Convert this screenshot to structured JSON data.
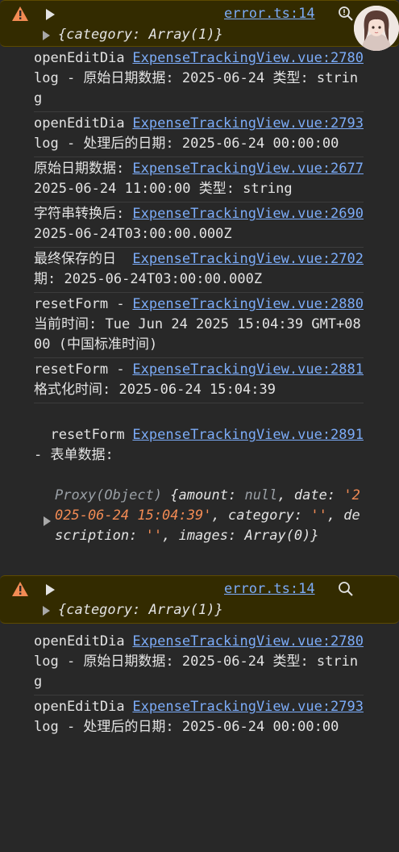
{
  "errors": [
    {
      "source": "error.ts:14",
      "object": "{category: Array(1)}"
    },
    {
      "source": "error.ts:14",
      "object": "{category: Array(1)}"
    }
  ],
  "logs1": [
    {
      "message": "openEditDialog - 原始日期数据: 2025-06-24 类型: string",
      "source": "ExpenseTrackingView.vue:2780"
    },
    {
      "message": "openEditDialog - 处理后的日期: 2025-06-24 00:00:00",
      "source": "ExpenseTrackingView.vue:2793"
    },
    {
      "message": "原始日期数据: 2025-06-24 11:00:00 类型: string",
      "source": "ExpenseTrackingView.vue:2677"
    },
    {
      "message": "字符串转换后: 2025-06-24T03:00:00.000Z",
      "source": "ExpenseTrackingView.vue:2690"
    },
    {
      "message": "最终保存的日期: 2025-06-24T03:00:00.000Z",
      "source": "ExpenseTrackingView.vue:2702"
    },
    {
      "message": "resetForm - 当前时间: Tue Jun 24 2025 15:04:39 GMT+0800 (中国标准时间)",
      "source": "ExpenseTrackingView.vue:2880"
    },
    {
      "message": "resetForm - 格式化时间: 2025-06-24 15:04:39",
      "source": "ExpenseTrackingView.vue:2881"
    }
  ],
  "proxy_log": {
    "message": "resetForm - 表单数据:",
    "source": "ExpenseTrackingView.vue:2891",
    "proxy_prefix": "Proxy(Object)",
    "proxy_open": " {",
    "k_amount": "amount",
    "v_amount": "null",
    "k_date": "date",
    "v_date": "'2025-06-24 15:04:39'",
    "k_category": "category",
    "v_category": "''",
    "k_description": "description",
    "v_description": "''",
    "k_images": "images",
    "v_images": "Array(0)",
    "proxy_close": "}"
  },
  "logs2": [
    {
      "message": "openEditDialog - 原始日期数据: 2025-06-24 类型: string",
      "source": "ExpenseTrackingView.vue:2780"
    },
    {
      "message": "openEditDialog - 处理后的日期: 2025-06-24 00:00:00",
      "source": "ExpenseTrackingView.vue:2793"
    }
  ],
  "colors": {
    "background": "#282828",
    "warning_bg": "#332b00",
    "link": "#7cacf8",
    "string": "#f28b54"
  }
}
